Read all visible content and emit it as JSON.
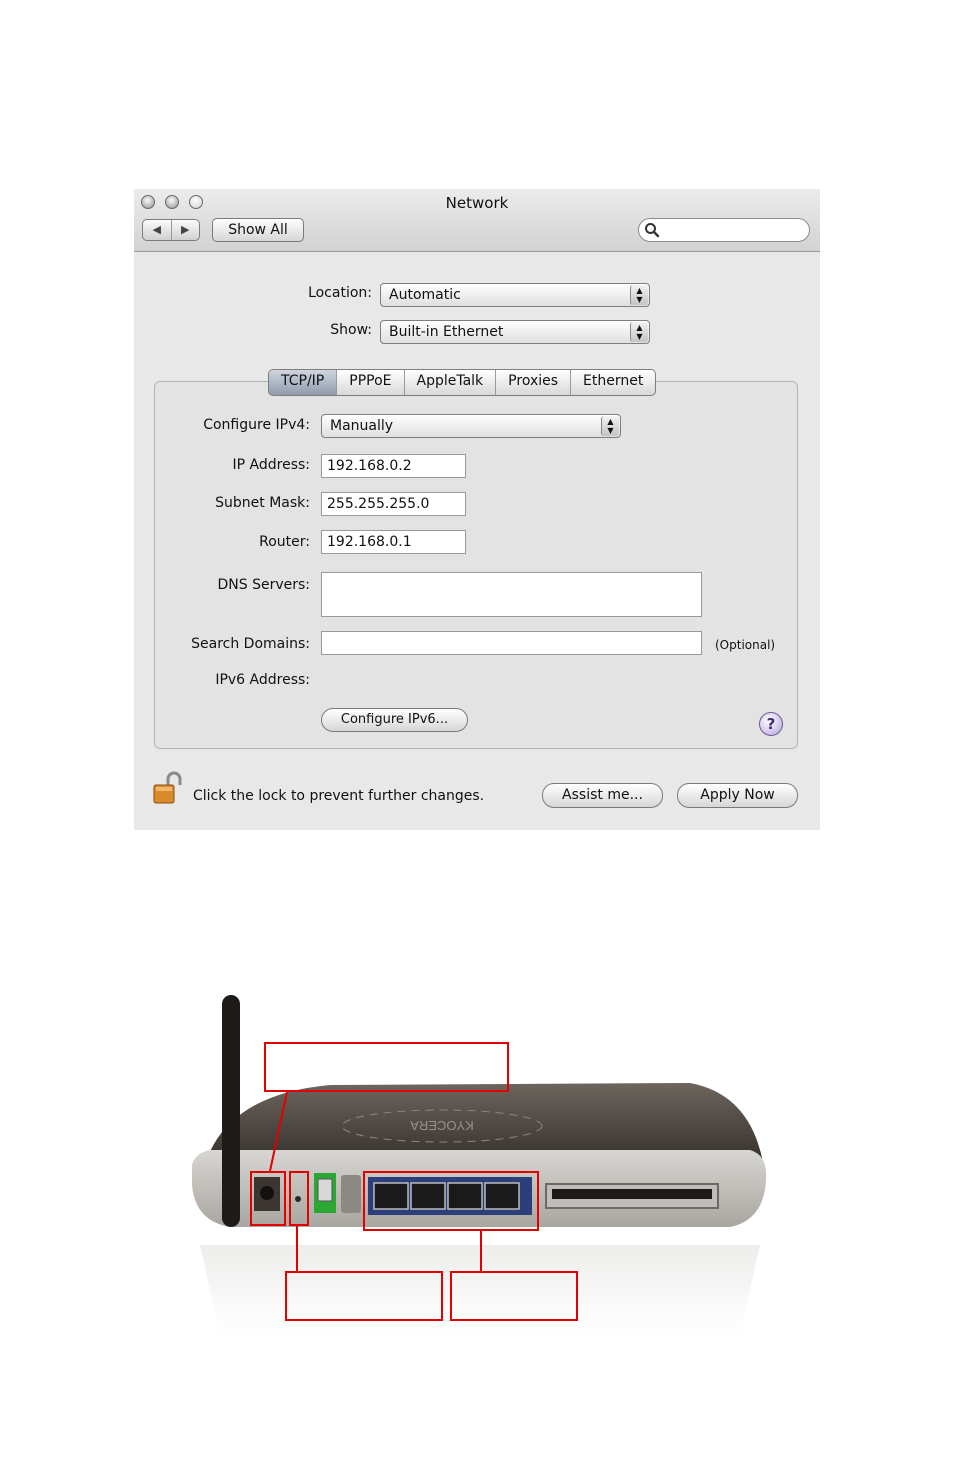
{
  "window": {
    "title": "Network",
    "show_all_label": "Show All",
    "back_glyph": "◀",
    "forward_glyph": "▶",
    "search_placeholder": "",
    "search_icon": "magnifier-icon"
  },
  "location": {
    "label": "Location:",
    "value": "Automatic"
  },
  "show": {
    "label": "Show:",
    "value": "Built-in Ethernet"
  },
  "tabs": [
    {
      "label": "TCP/IP",
      "active": true
    },
    {
      "label": "PPPoE",
      "active": false
    },
    {
      "label": "AppleTalk",
      "active": false
    },
    {
      "label": "Proxies",
      "active": false
    },
    {
      "label": "Ethernet",
      "active": false
    }
  ],
  "tcpip": {
    "configure_label": "Configure IPv4:",
    "configure_value": "Manually",
    "ip_label": "IP Address:",
    "ip_value": "192.168.0.2",
    "subnet_label": "Subnet Mask:",
    "subnet_value": "255.255.255.0",
    "router_label": "Router:",
    "router_value": "192.168.0.1",
    "dns_label": "DNS Servers:",
    "dns_value": "",
    "search_domains_label": "Search Domains:",
    "search_domains_value": "",
    "optional_note": "(Optional)",
    "ipv6_label": "IPv6 Address:",
    "configure_ipv6_label": "Configure IPv6...",
    "help_glyph": "?"
  },
  "footer": {
    "lock_text": "Click the lock to prevent further changes.",
    "assist_label": "Assist me...",
    "apply_label": "Apply Now"
  },
  "router_photo": {
    "brand_text": "KYOCERA",
    "callout_power_text": "",
    "callout_reset_text": "",
    "callout_lan_text": "",
    "colors": {
      "callout": "#e30000",
      "usb_port": "#2aa832",
      "lan_port": "#2d3f7a"
    }
  }
}
